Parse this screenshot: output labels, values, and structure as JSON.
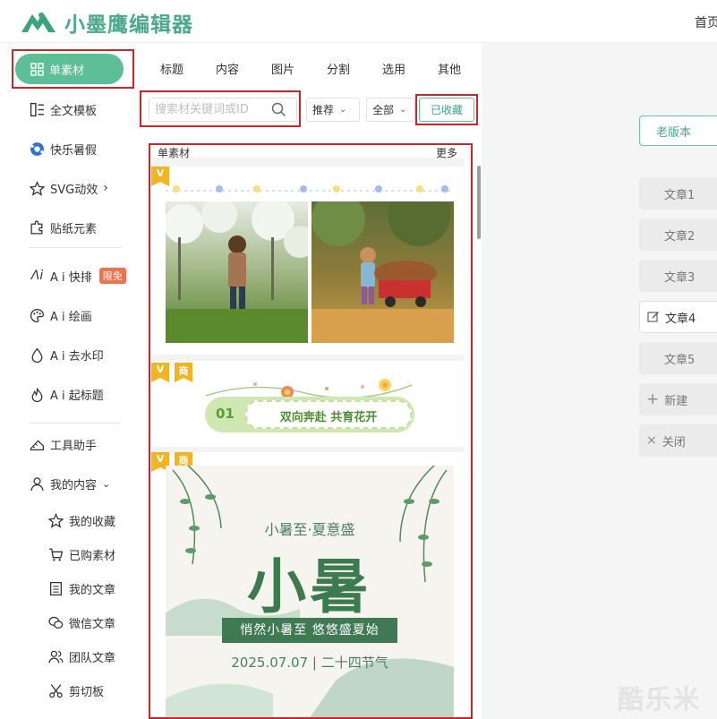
{
  "app": {
    "logo_text": "小墨鹰编辑器",
    "top_nav_home": "首页"
  },
  "colors": {
    "brand": "#5dbf98",
    "highlight_box": "#d2232a",
    "badge": "#f2704a"
  },
  "left_nav": {
    "active": "单素材",
    "items": [
      "全文模板",
      "快乐暑假",
      "SVG动效",
      "贴纸元素",
      "A i 快排",
      "A i 绘画",
      "A i 去水印",
      "A i 起标题",
      "工具助手",
      "我的内容"
    ],
    "ai_layout_badge": "限免",
    "sub_items": [
      "我的收藏",
      "已购素材",
      "我的文章",
      "微信文章",
      "团队文章",
      "剪切板"
    ]
  },
  "panel": {
    "tabs": [
      "标题",
      "内容",
      "图片",
      "分割",
      "选用",
      "其他"
    ],
    "search_placeholder": "搜索材关键词或ID",
    "sort_select": "推荐",
    "scope_select": "全部",
    "favorites_button": "已收藏",
    "list_title": "单素材",
    "more_link": "更多"
  },
  "cards": {
    "badge_v": "V",
    "badge_commercial": "商",
    "divider_number": "01",
    "divider_text": "双向奔赴 共育花开",
    "poster": {
      "subtitle": "小暑至·夏意盛",
      "title": "小暑",
      "band": "悄然小暑至 悠悠盛夏始",
      "date": "2025.07.07 | 二十四节气"
    }
  },
  "right_panel": {
    "old_version": "老版本",
    "articles": [
      "文章1",
      "文章2",
      "文章3",
      "文章4",
      "文章5"
    ],
    "active_article": "文章4",
    "new_label": "新建",
    "close_label": "关闭"
  },
  "watermark": "酷乐米"
}
